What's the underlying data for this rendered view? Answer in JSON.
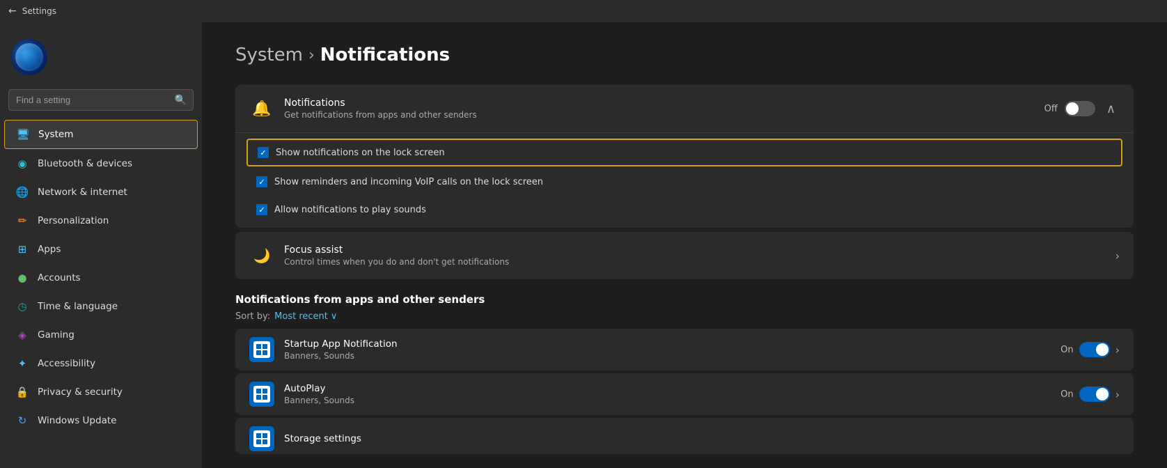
{
  "titleBar": {
    "title": "Settings",
    "backLabel": "←"
  },
  "sidebar": {
    "searchPlaceholder": "Find a setting",
    "items": [
      {
        "id": "system",
        "label": "System",
        "icon": "🖥",
        "iconClass": "blue",
        "active": true
      },
      {
        "id": "bluetooth",
        "label": "Bluetooth & devices",
        "icon": "🔵",
        "iconClass": "cyan",
        "active": false
      },
      {
        "id": "network",
        "label": "Network & internet",
        "icon": "🌐",
        "iconClass": "cyan",
        "active": false
      },
      {
        "id": "personalization",
        "label": "Personalization",
        "icon": "✏️",
        "iconClass": "orange",
        "active": false
      },
      {
        "id": "apps",
        "label": "Apps",
        "icon": "📱",
        "iconClass": "blue",
        "active": false
      },
      {
        "id": "accounts",
        "label": "Accounts",
        "icon": "👤",
        "iconClass": "green",
        "active": false
      },
      {
        "id": "time",
        "label": "Time & language",
        "icon": "🕐",
        "iconClass": "teal",
        "active": false
      },
      {
        "id": "gaming",
        "label": "Gaming",
        "icon": "🎮",
        "iconClass": "purple",
        "active": false
      },
      {
        "id": "accessibility",
        "label": "Accessibility",
        "icon": "♿",
        "iconClass": "blue",
        "active": false
      },
      {
        "id": "privacy",
        "label": "Privacy & security",
        "icon": "🔒",
        "iconClass": "blue",
        "active": false
      },
      {
        "id": "update",
        "label": "Windows Update",
        "icon": "🔄",
        "iconClass": "lightblue",
        "active": false
      }
    ]
  },
  "content": {
    "breadcrumb": {
      "system": "System",
      "separator": "›",
      "current": "Notifications"
    },
    "notificationsCard": {
      "icon": "🔔",
      "title": "Notifications",
      "subtitle": "Get notifications from apps and other senders",
      "toggleState": "Off",
      "isOn": false
    },
    "subOptions": [
      {
        "id": "lock-screen",
        "label": "Show notifications on the lock screen",
        "checked": true,
        "highlighted": true
      },
      {
        "id": "voip",
        "label": "Show reminders and incoming VoIP calls on the lock screen",
        "checked": true,
        "highlighted": false
      },
      {
        "id": "sounds",
        "label": "Allow notifications to play sounds",
        "checked": true,
        "highlighted": false
      }
    ],
    "focusAssist": {
      "icon": "🌙",
      "title": "Focus assist",
      "subtitle": "Control times when you do and don't get notifications"
    },
    "appsSection": {
      "title": "Notifications from apps and other senders",
      "sortBy": "Sort by:",
      "sortValue": "Most recent",
      "apps": [
        {
          "id": "startup",
          "name": "Startup App Notification",
          "sub": "Banners, Sounds",
          "toggleState": "On",
          "isOn": true
        },
        {
          "id": "autoplay",
          "name": "AutoPlay",
          "sub": "Banners, Sounds",
          "toggleState": "On",
          "isOn": true
        },
        {
          "id": "storage",
          "name": "Storage settings",
          "sub": "",
          "toggleState": "",
          "isOn": false,
          "partial": true
        }
      ]
    }
  }
}
